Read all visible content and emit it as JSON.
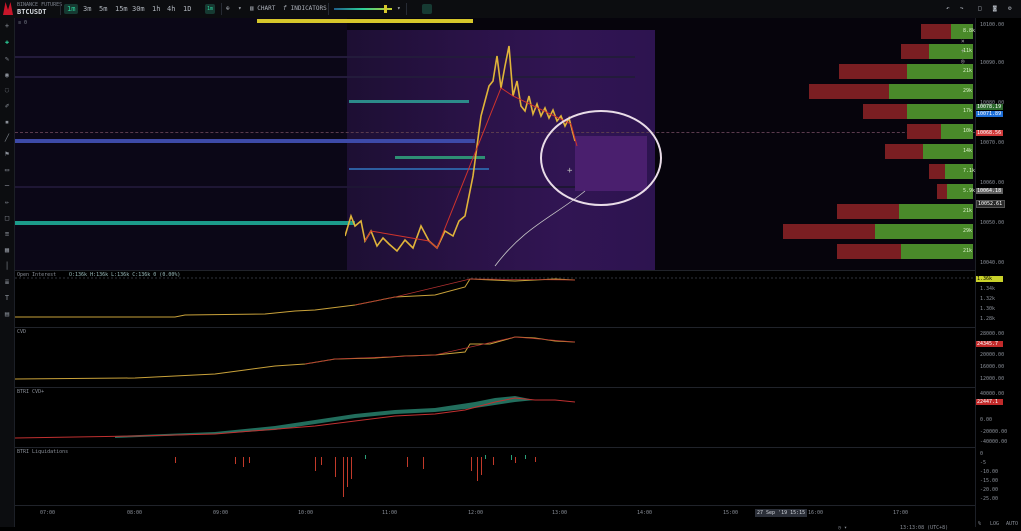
{
  "toolbar": {
    "exchange": "BINANCE FUTURES",
    "symbol": "BTCUSDT",
    "timeframes": [
      "1m",
      "3m",
      "5m",
      "15m",
      "30m",
      "1h",
      "4h",
      "1D"
    ],
    "active_timeframe": "1m",
    "chart_label": "CHART",
    "indicators_label": "INDICATORS",
    "fx_icon": "f",
    "brand_color": "#c8162a",
    "accent_color": "#2bd19a"
  },
  "price_axis": {
    "ticks": [
      "10100.00",
      "10090.00",
      "10080.00",
      "10070.00",
      "10060.00",
      "10050.00",
      "10040.00",
      "10030.00",
      "10020.00"
    ],
    "tags": [
      {
        "text": "10078.19",
        "color": "#2d6a2d"
      },
      {
        "text": "10071.89",
        "color": "#1e6fd8"
      },
      {
        "text": "10068.56",
        "color": "#d23c3c"
      },
      {
        "text": "10064.18",
        "color": "#606060"
      },
      {
        "text": "10052.61",
        "color": "#2a2a2a"
      }
    ],
    "cursor_tag": "10053.10"
  },
  "volume_profile": [
    {
      "label": "8.8k",
      "sell": 30,
      "buy": 22
    },
    {
      "label": "11k",
      "sell": 28,
      "buy": 44
    },
    {
      "label": "21k",
      "sell": 68,
      "buy": 66
    },
    {
      "label": "29k",
      "sell": 80,
      "buy": 84
    },
    {
      "label": "17k",
      "sell": 44,
      "buy": 66
    },
    {
      "label": "10k",
      "sell": 34,
      "buy": 32
    },
    {
      "label": "14k",
      "sell": 38,
      "buy": 50
    },
    {
      "label": "7.1k",
      "sell": 16,
      "buy": 28
    },
    {
      "label": "5.9k",
      "sell": 10,
      "buy": 26
    },
    {
      "label": "21k",
      "sell": 62,
      "buy": 74
    },
    {
      "label": "29k",
      "sell": 92,
      "buy": 98
    },
    {
      "label": "21k",
      "sell": 64,
      "buy": 72
    }
  ],
  "panes": [
    {
      "title": "Open Interest",
      "values": "O:136k H:136k L:136k C:136k 0 (0.00%)",
      "ticks": [
        "1.36k",
        "1.34k",
        "1.32k",
        "1.30k",
        "1.28k",
        "1.26k"
      ],
      "tag": "1.36k",
      "tag_color": "#c9d12a"
    },
    {
      "title": "CVD",
      "values": "",
      "ticks": [
        "28000.00",
        "24000.00",
        "20000.00",
        "16000.00",
        "12000.00"
      ],
      "tag": "24345.7",
      "tag_color": "#c22b2b"
    },
    {
      "title": "BTRI CVD+",
      "values": "",
      "ticks": [
        "40000.00",
        "20000.00",
        "0.00",
        "-20000.00",
        "-40000.00"
      ],
      "tag": "22447.1",
      "tag_color": "#c22b2b"
    },
    {
      "title": "BTRI Liquidations",
      "values": "",
      "ticks": [
        "0",
        "-5",
        "-10.00",
        "-15.00",
        "-20.00",
        "-25.00"
      ],
      "tag": "",
      "tag_color": ""
    }
  ],
  "time_axis": {
    "labels": [
      "07:00",
      "08:00",
      "09:00",
      "10:00",
      "11:00",
      "12:00",
      "13:00",
      "14:00",
      "15:00",
      "16:00",
      "17:00"
    ],
    "cursor_label": "27 Sep '19 15:15"
  },
  "status_bar": {
    "clock": "13:13:08 (UTC+8)",
    "pct": "%",
    "log": "LOG",
    "auto": "AUTO"
  },
  "indicator_label": "≡ 0"
}
